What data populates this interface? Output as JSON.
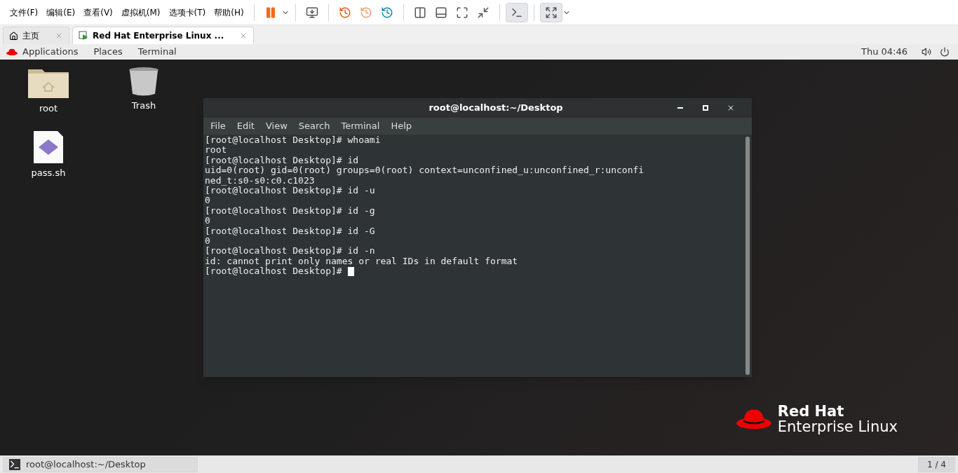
{
  "menu_bar": [
    "文件(F)",
    "编辑(E)",
    "查看(V)",
    "虚拟机(M)",
    "选项卡(T)",
    "帮助(H)"
  ],
  "tabs": [
    {
      "label": "主页",
      "selected": false
    },
    {
      "label": "Red Hat Enterprise Linux ...",
      "selected": true
    }
  ],
  "top_bar": {
    "menus": [
      "Applications",
      "Places",
      "Terminal"
    ],
    "clock": "Thu 04:46"
  },
  "desktop_icons": [
    {
      "label": "root",
      "kind": "folder"
    },
    {
      "label": "Trash",
      "kind": "trash"
    },
    {
      "label": "pass.sh",
      "kind": "script"
    }
  ],
  "terminal": {
    "title": "root@localhost:~/Desktop",
    "menus": [
      "File",
      "Edit",
      "View",
      "Search",
      "Terminal",
      "Help"
    ],
    "lines": [
      "[root@localhost Desktop]# whoami",
      "root",
      "[root@localhost Desktop]# id",
      "uid=0(root) gid=0(root) groups=0(root) context=unconfined_u:unconfined_r:unconfi",
      "ned_t:s0-s0:c0.c1023",
      "[root@localhost Desktop]# id -u",
      "0",
      "[root@localhost Desktop]# id -g",
      "0",
      "[root@localhost Desktop]# id -G",
      "0",
      "[root@localhost Desktop]# id -n",
      "id: cannot print only names or real IDs in default format"
    ],
    "prompt": "[root@localhost Desktop]# "
  },
  "logo": {
    "line_1": "Red Hat",
    "line_2": "Enterprise Linux"
  },
  "taskbar": {
    "window": "root@localhost:~/Desktop",
    "workspace": "1 / 4"
  }
}
